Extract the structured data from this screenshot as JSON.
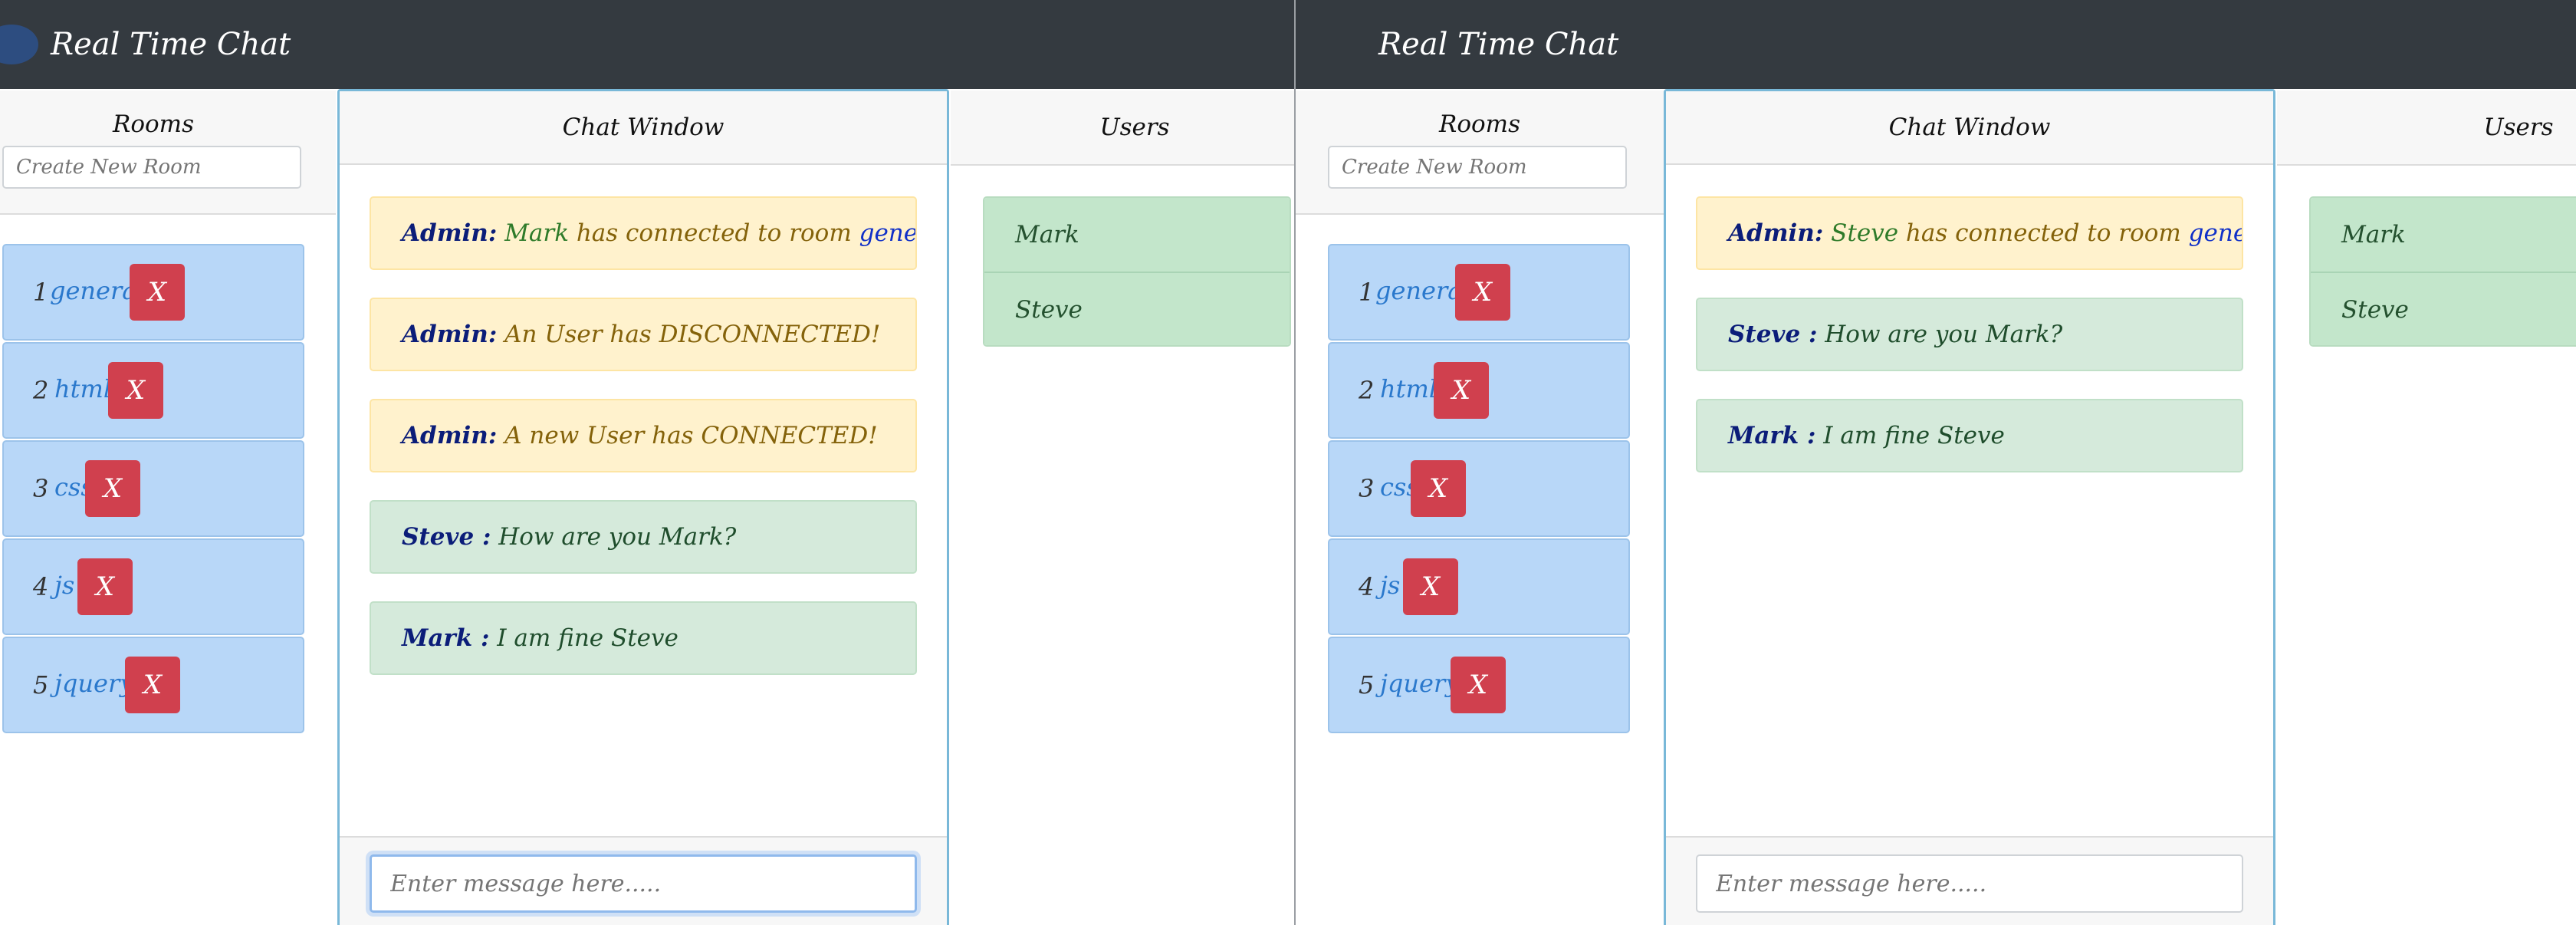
{
  "left_window": {
    "brand": "Real Time Chat",
    "rooms": {
      "header": "Rooms",
      "create_placeholder": "Create New Room",
      "items": [
        {
          "num": "1",
          "name": "general",
          "delete": "X"
        },
        {
          "num": "2",
          "name": "html",
          "delete": "X"
        },
        {
          "num": "3",
          "name": "css",
          "delete": "X"
        },
        {
          "num": "4",
          "name": "js",
          "delete": "X"
        },
        {
          "num": "5",
          "name": "jquery",
          "delete": "X"
        }
      ]
    },
    "chat": {
      "header": "Chat Window",
      "messages": [
        {
          "sender": "Admin:",
          "parts": [
            "Mark",
            " has connected to room ",
            "general"
          ]
        },
        {
          "sender": "Admin:",
          "text": " An User has DISCONNECTED!"
        },
        {
          "sender": "Admin:",
          "text": " A new User has CONNECTED!"
        },
        {
          "sender": "Steve :",
          "text": " How are you Mark?"
        },
        {
          "sender": "Mark :",
          "text": " I am fine Steve"
        }
      ],
      "input_placeholder": "Enter message here....."
    },
    "users": {
      "header": "Users",
      "items": [
        "Mark",
        "Steve"
      ]
    }
  },
  "right_window": {
    "brand": "Real Time Chat",
    "rooms": {
      "header": "Rooms",
      "create_placeholder": "Create New Room",
      "items": [
        {
          "num": "1",
          "name": "general",
          "delete": "X"
        },
        {
          "num": "2",
          "name": "html",
          "delete": "X"
        },
        {
          "num": "3",
          "name": "css",
          "delete": "X"
        },
        {
          "num": "4",
          "name": "js",
          "delete": "X"
        },
        {
          "num": "5",
          "name": "jquery",
          "delete": "X"
        }
      ]
    },
    "chat": {
      "header": "Chat Window",
      "messages": [
        {
          "sender": "Admin:",
          "parts": [
            "Steve",
            " has connected to room ",
            "general"
          ]
        },
        {
          "sender": "Steve :",
          "text": " How are you Mark?"
        },
        {
          "sender": "Mark :",
          "text": " I am fine Steve"
        }
      ],
      "input_placeholder": "Enter message here....."
    },
    "users": {
      "header": "Users",
      "items": [
        "Mark",
        "Steve"
      ]
    }
  },
  "colors": {
    "navbar": "#343a40",
    "room_item": "#b8d7f8",
    "delete_button": "#d0404e",
    "admin_message": "#fff2cd",
    "user_message": "#d5eadb",
    "user_item": "#c3e6cb",
    "chat_border": "#79b8d8"
  },
  "icons": {
    "brand_logo": "circle-logo-icon"
  }
}
